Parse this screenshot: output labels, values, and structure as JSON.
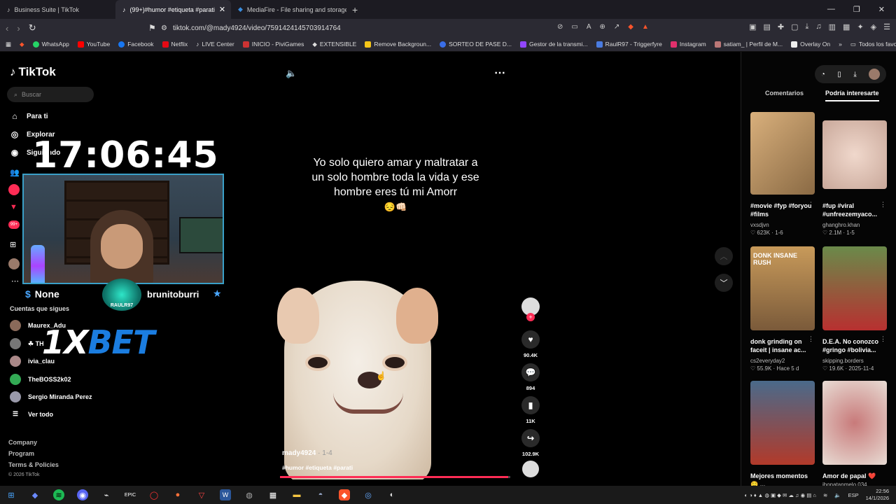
{
  "browser": {
    "tabs": [
      {
        "title": "Business Suite | TikTok"
      },
      {
        "title": "(99+)#humor #etiqueta #parati"
      },
      {
        "title": "MediaFire - File sharing and storage"
      }
    ],
    "url": "tiktok.com/@mady4924/video/7591424145703914764",
    "bookmarks": [
      "WhatsApp",
      "YouTube",
      "Facebook",
      "Netflix",
      "LIVE Center",
      "INICIO - PiviGames",
      "EXTENSIBLE",
      "Remove Backgroun...",
      "SORTEO DE PASE D...",
      "Gestor de la transmi...",
      "RaulR97 - Triggerfyre",
      "Instagram",
      "satiam_ | Perfil de M...",
      "Overlay On"
    ],
    "bookmarks_all": "Todos los favoritos"
  },
  "sidebar": {
    "logo": "TikTok",
    "search_placeholder": "Buscar",
    "nav": [
      {
        "label": "Para ti"
      },
      {
        "label": "Explorar"
      },
      {
        "label": "Siguiendo"
      }
    ],
    "follows_heading": "Cuentas que sigues",
    "follows": [
      {
        "name": "Maurex_Adu"
      },
      {
        "name": "☘ TH"
      },
      {
        "name": "ivia_clau"
      },
      {
        "name": "TheBOSS2k02"
      },
      {
        "name": "Sergio Miranda Perez"
      }
    ],
    "see_all": "Ver todo",
    "footer": [
      "Company",
      "Program",
      "Terms & Policies"
    ],
    "copyright": "© 2026 TikTok"
  },
  "overlay": {
    "clock": "17:06:45",
    "left_name": "None",
    "right_name": "brunitoburri",
    "badge": "RAULR97",
    "sponsor_a": "1X",
    "sponsor_b": "BET"
  },
  "video": {
    "caption": "Yo solo quiero amar y maltratar a un solo hombre toda la vida y ese hombre eres tú mi Amorr",
    "emoji": "😔👊🏻",
    "author": "mady4924",
    "date": " · 1-4",
    "hashtags": "#humor #etiqueta #parati",
    "progress": 0.99,
    "likes": "90.4K",
    "comments": "894",
    "saves": "11K",
    "shares": "102.9K"
  },
  "right_panel": {
    "tabs": [
      "Comentarios",
      "Podría interesarte"
    ],
    "cards": [
      {
        "title": "#movie #fyp #foryou #films",
        "user": "vxsdjvn",
        "stats": "♡ 623K · 1-6"
      },
      {
        "title": "#fup #viral #unfreezemyaco...",
        "user": "ghanghro.khan",
        "stats": "♡ 2.1M · 1-5"
      },
      {
        "title": "donk grinding on faceit | insane ac...",
        "user": "cs2everyday2",
        "stats": "♡ 55.9K · Hace 5 d"
      },
      {
        "title": "D.E.A. No conozco #gringo #bolivia...",
        "user": "skipping.borders",
        "stats": "♡ 19.6K · 2025-11-4"
      },
      {
        "title": "Mejores momentos 🤤 ...",
        "user": "",
        "stats": ""
      },
      {
        "title": "Amor de papal ❤️",
        "user": "jhonatanmelo 034",
        "stats": ""
      }
    ],
    "card3_overlay": "DONK INSANE RUSH"
  },
  "taskbar": {
    "lang": "ESP",
    "time": "22:56",
    "date": "14/1/2026"
  }
}
